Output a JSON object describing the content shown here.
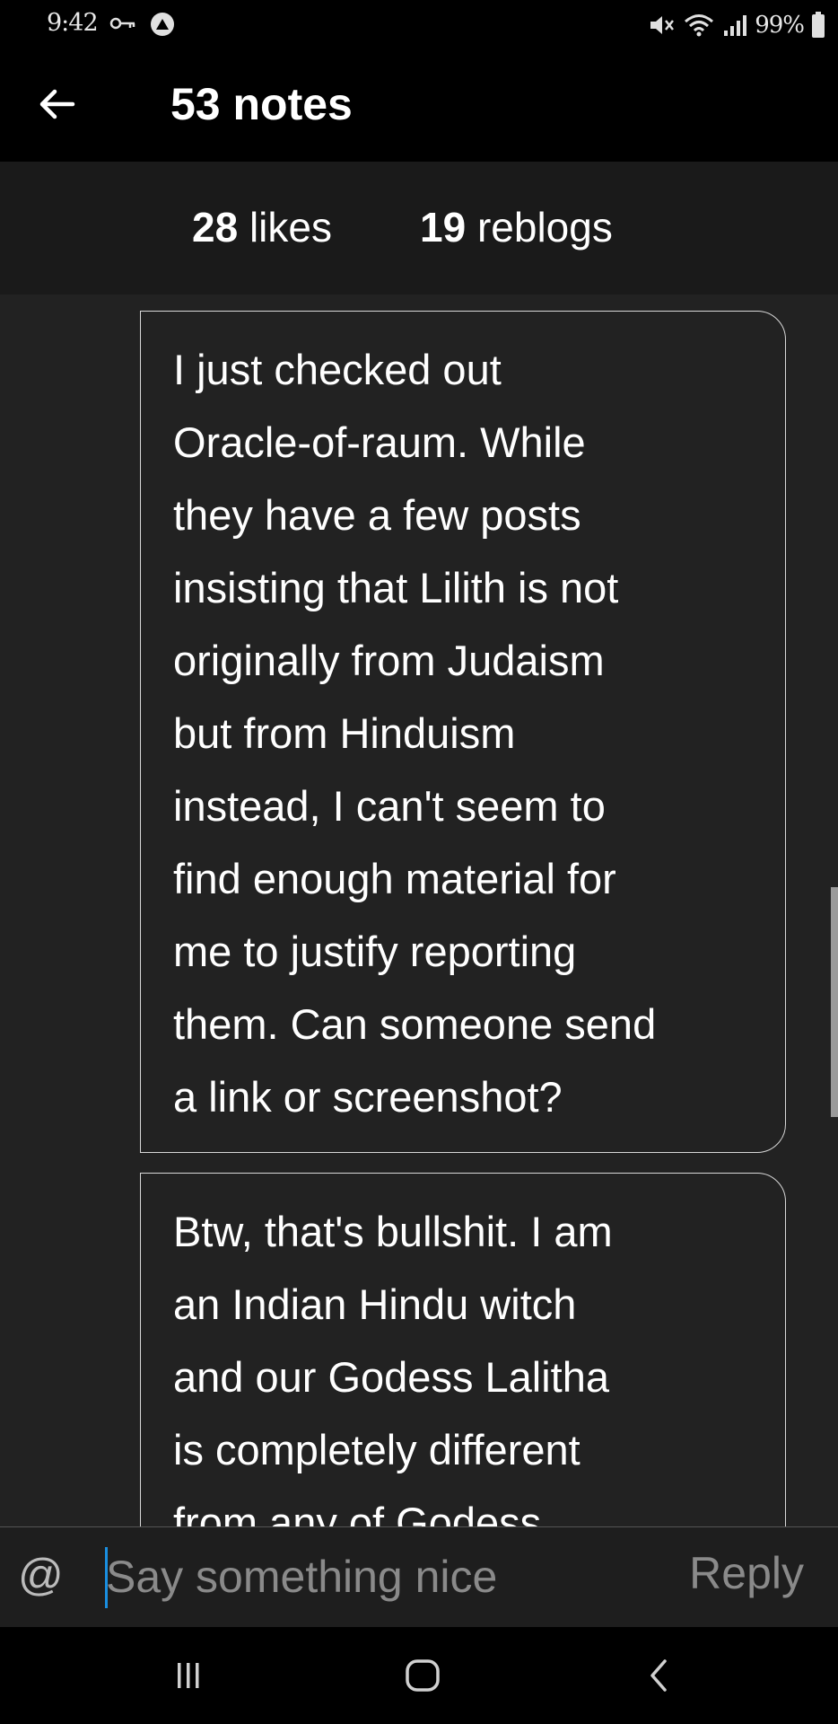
{
  "status_bar": {
    "time": "9:42",
    "battery_percent": "99%",
    "icons": [
      "key-icon",
      "app-notification-icon",
      "mute-icon",
      "wifi-icon",
      "signal-icon",
      "battery-icon"
    ]
  },
  "header": {
    "back_icon": "arrow-left-icon",
    "title": "53 notes"
  },
  "tabs": [
    {
      "count": "28",
      "label": "likes"
    },
    {
      "count": "19",
      "label": "reblogs"
    }
  ],
  "notes": [
    {
      "text": "I just checked out\nOracle-of-raum. While\nthey have a few posts\ninsisting that Lilith is not\noriginally from Judaism\nbut from Hinduism\ninstead, I can't seem to\nfind enough material for\nme to justify reporting\nthem. Can someone send\na link or screenshot?"
    },
    {
      "text": "Btw, that's bullshit. I am\nan Indian Hindu witch\nand our Godess Lalitha\nis completely different\nfrom any of Godess"
    }
  ],
  "reply_bar": {
    "mention_label": "@",
    "placeholder": "Say something nice",
    "value": "",
    "reply_label": "Reply"
  },
  "nav_bar": {
    "icons": [
      "recent-apps-icon",
      "home-icon",
      "back-icon"
    ]
  },
  "colors": {
    "background": "#000000",
    "content_background": "#222222",
    "tabs_background": "#1a1a1a",
    "caret": "#1a8fe0",
    "muted_text": "#8a8a8a"
  }
}
